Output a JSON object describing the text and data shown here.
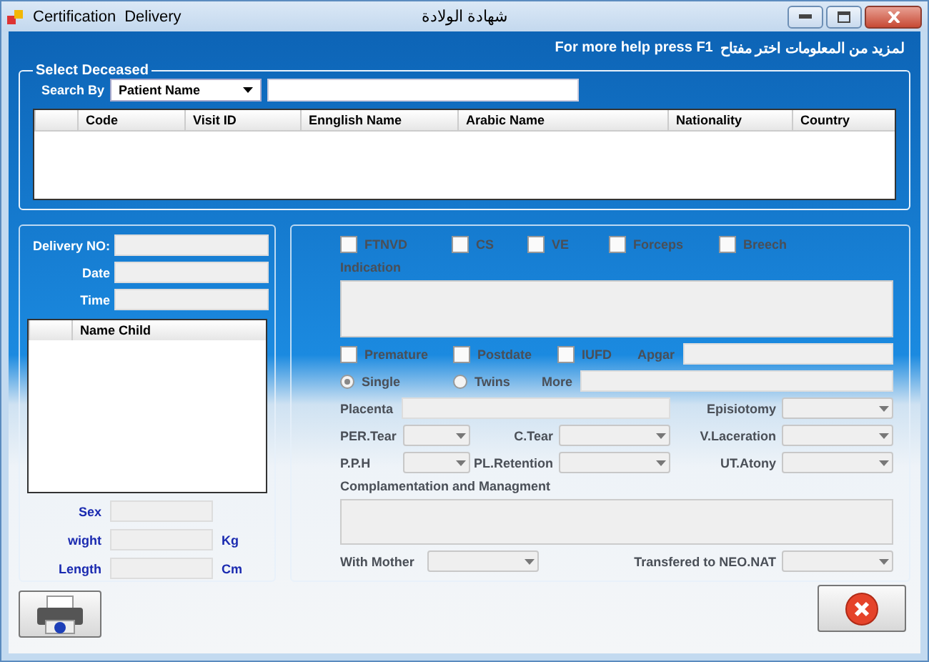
{
  "window": {
    "title": "شهادة الولادة",
    "menu": [
      "Certification",
      "Delivery"
    ]
  },
  "help": {
    "en": "For more help press F1",
    "ar": "لمزيد من المعلومات اختر مفتاح"
  },
  "select_deceased": {
    "title": "Select Deceased",
    "search_label": "Search By",
    "search_by": "Patient Name",
    "columns": [
      "Code",
      "Visit ID",
      "Ennglish Name",
      "Arabic Name",
      "Nationality",
      "Country"
    ]
  },
  "delivery": {
    "fields": [
      {
        "label": "Delivery NO:"
      },
      {
        "label": "Date"
      },
      {
        "label": "Time"
      }
    ],
    "child_columns": [
      "Name Child"
    ],
    "measures": [
      {
        "label": "Sex"
      },
      {
        "label": "wight",
        "unit": "Kg"
      },
      {
        "label": "Length",
        "unit": "Cm"
      }
    ]
  },
  "details": {
    "disabled": true,
    "types": [
      {
        "label": "FTNVD",
        "checked": false
      },
      {
        "label": "CS",
        "checked": false
      },
      {
        "label": "VE",
        "checked": false
      },
      {
        "label": "Forceps",
        "checked": false
      },
      {
        "label": "Breech",
        "checked": false
      }
    ],
    "indication": "Indication",
    "flags": [
      {
        "label": "Premature",
        "checked": false
      },
      {
        "label": "Postdate",
        "checked": false
      },
      {
        "label": "IUFD",
        "checked": false
      }
    ],
    "apgar": "Apgar",
    "births": [
      {
        "label": "Single",
        "selected": true
      },
      {
        "label": "Twins",
        "selected": false
      }
    ],
    "more": "More",
    "placenta": "Placenta",
    "episiotomy": "Episiotomy",
    "per_tear": "PER.Tear",
    "c_tear": "C.Tear",
    "v_laceration": "V.Laceration",
    "pph": "P.P.H",
    "pl_retention": "PL.Retention",
    "ut_atony": "UT.Atony",
    "complications": "Complamentation and Managment",
    "with_mother": "With Mother",
    "transferred": "Transfered to NEO.NAT"
  }
}
